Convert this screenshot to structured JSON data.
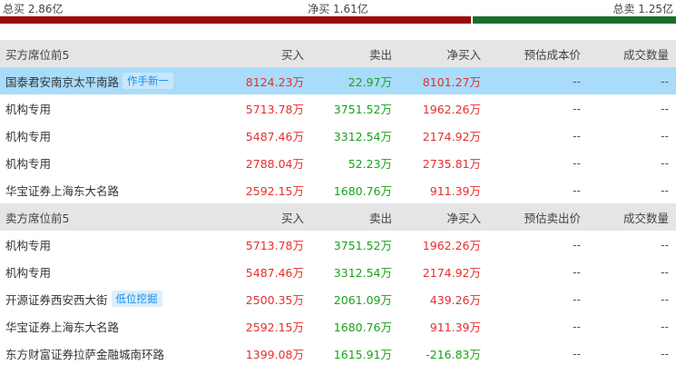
{
  "summary": {
    "total_buy": "总买 2.86亿",
    "net_buy": "净买 1.61亿",
    "total_sell": "总卖 1.25亿",
    "buy_fraction": 0.696
  },
  "colors": {
    "buy_bar": "#9a0a0a",
    "sell_bar": "#1b6e2b",
    "up": "#e62e2e",
    "down": "#1aa21a",
    "highlight": "#a9dcfb"
  },
  "buyers": {
    "headers": [
      "买方席位前5",
      "买入",
      "卖出",
      "净买入",
      "预估成本价",
      "成交数量"
    ],
    "rows": [
      {
        "name": "国泰君安南京太平南路",
        "tag": "作手新一",
        "buy": "8124.23万",
        "sell": "22.97万",
        "net": "8101.27万",
        "price": "--",
        "volume": "--"
      },
      {
        "name": "机构专用",
        "tag": "",
        "buy": "5713.78万",
        "sell": "3751.52万",
        "net": "1962.26万",
        "price": "--",
        "volume": "--"
      },
      {
        "name": "机构专用",
        "tag": "",
        "buy": "5487.46万",
        "sell": "3312.54万",
        "net": "2174.92万",
        "price": "--",
        "volume": "--"
      },
      {
        "name": "机构专用",
        "tag": "",
        "buy": "2788.04万",
        "sell": "52.23万",
        "net": "2735.81万",
        "price": "--",
        "volume": "--"
      },
      {
        "name": "华宝证券上海东大名路",
        "tag": "",
        "buy": "2592.15万",
        "sell": "1680.76万",
        "net": "911.39万",
        "price": "--",
        "volume": "--"
      }
    ]
  },
  "sellers": {
    "headers": [
      "卖方席位前5",
      "买入",
      "卖出",
      "净买入",
      "预估卖出价",
      "成交数量"
    ],
    "rows": [
      {
        "name": "机构专用",
        "tag": "",
        "buy": "5713.78万",
        "sell": "3751.52万",
        "net": "1962.26万",
        "price": "--",
        "volume": "--"
      },
      {
        "name": "机构专用",
        "tag": "",
        "buy": "5487.46万",
        "sell": "3312.54万",
        "net": "2174.92万",
        "price": "--",
        "volume": "--"
      },
      {
        "name": "开源证券西安西大街",
        "tag": "低位挖掘",
        "buy": "2500.35万",
        "sell": "2061.09万",
        "net": "439.26万",
        "price": "--",
        "volume": "--"
      },
      {
        "name": "华宝证券上海东大名路",
        "tag": "",
        "buy": "2592.15万",
        "sell": "1680.76万",
        "net": "911.39万",
        "price": "--",
        "volume": "--"
      },
      {
        "name": "东方财富证券拉萨金融城南环路",
        "tag": "",
        "buy": "1399.08万",
        "sell": "1615.91万",
        "net": "-216.83万",
        "price": "--",
        "volume": "--"
      }
    ]
  }
}
